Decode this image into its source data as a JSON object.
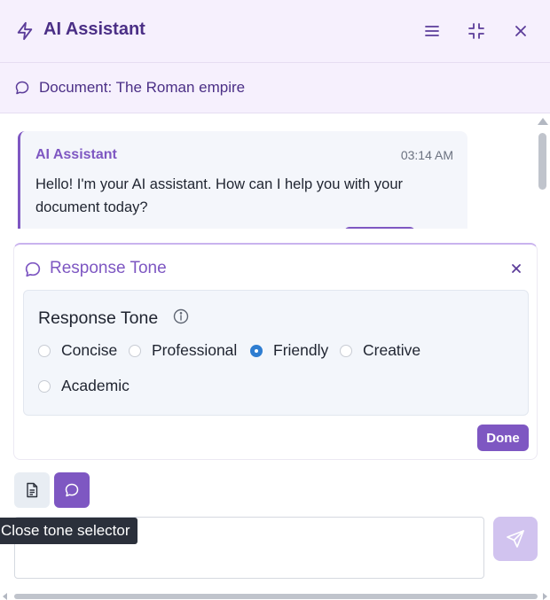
{
  "header": {
    "title": "AI Assistant",
    "icons": {
      "logo": "bolt-icon",
      "menu": "menu-icon",
      "minimize": "minimize-icon",
      "close": "close-icon"
    }
  },
  "document": {
    "label": "Document: The Roman empire",
    "icon": "chat-bubble-icon"
  },
  "messages": [
    {
      "sender": "AI Assistant",
      "time": "03:14 AM",
      "text": "Hello! I'm your AI assistant. How can I help you with your document today?"
    }
  ],
  "tone_panel": {
    "header_title": "Response Tone",
    "box_title": "Response Tone",
    "options": [
      {
        "label": "Concise",
        "selected": false
      },
      {
        "label": "Professional",
        "selected": false
      },
      {
        "label": "Friendly",
        "selected": true
      },
      {
        "label": "Creative",
        "selected": false
      },
      {
        "label": "Academic",
        "selected": false
      }
    ],
    "done_label": "Done"
  },
  "toolbar": {
    "tooltip": "Close tone selector",
    "icons": {
      "document": "document-icon",
      "tone": "chat-bubble-icon",
      "send": "send-icon"
    }
  },
  "input": {
    "value": ""
  },
  "colors": {
    "accent": "#7e57c2",
    "header_bg": "#f6f0fd",
    "title_text": "#4b2f86",
    "radio_selected": "#2e7dd1",
    "send_disabled": "#d1c3ef",
    "tooltip_bg": "#2b303b"
  }
}
